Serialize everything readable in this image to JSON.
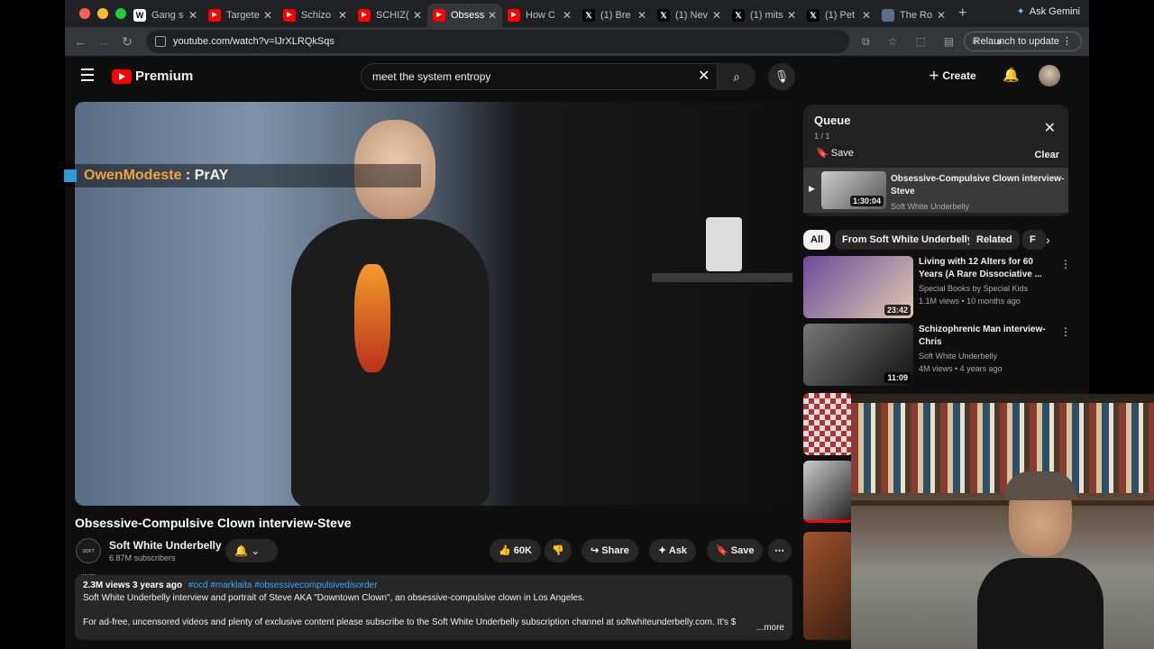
{
  "browser": {
    "tabs": [
      {
        "label": "Gang s",
        "fav": "W",
        "color": "#ffffff"
      },
      {
        "label": "Targete",
        "fav": "yt",
        "color": "#ff0000"
      },
      {
        "label": "Schizo",
        "fav": "yt",
        "color": "#ff0000"
      },
      {
        "label": "SCHIZ(",
        "fav": "yt",
        "color": "#ff0000"
      },
      {
        "label": "Obsess",
        "fav": "yt",
        "color": "#ff0000"
      },
      {
        "label": "How C",
        "fav": "yt",
        "color": "#ff0000"
      },
      {
        "label": "(1) Bre",
        "fav": "X",
        "color": "#000000"
      },
      {
        "label": "(1) Nev",
        "fav": "X",
        "color": "#000000"
      },
      {
        "label": "(1) mits",
        "fav": "X",
        "color": "#000000"
      },
      {
        "label": "(1) Pet",
        "fav": "X",
        "color": "#000000"
      },
      {
        "label": "The Ro",
        "fav": "doc",
        "color": "#5b6b8c"
      }
    ],
    "active_tab": 4,
    "gemini_label": "Ask Gemini",
    "url": "youtube.com/watch?v=lJrXLRQkSqs",
    "relaunch_label": "Relaunch to update"
  },
  "youtube": {
    "logo_text": "Premium",
    "search_value": "meet the system entropy",
    "create_label": "Create",
    "video_overlay": {
      "user": "OwenModeste",
      "message": " : PrAY"
    },
    "video_title": "Obsessive-Compulsive Clown interview-Steve",
    "channel": {
      "name": "Soft White Underbelly",
      "subscribers": "6.87M subscribers",
      "logo_text": "SOFT WHITE UNDERBELLY"
    },
    "actions": {
      "likes": "60K",
      "share": "Share",
      "ask": "Ask",
      "save": "Save"
    },
    "description": {
      "views": "2.3M views",
      "age": "3 years ago",
      "tags": "#ocd #marklaita #obsessivecompulsivedisorder",
      "line1": "Soft White Underbelly interview and portrait of Steve AKA \"Downtown Clown\", an obsessive-compulsive clown in Los Angeles.",
      "line2": "For ad-free, uncensored videos and plenty of exclusive content please subscribe to the Soft White Underbelly subscription channel at softwhiteunderbelly.com. It's $",
      "more": "...more"
    },
    "queue": {
      "title": "Queue",
      "count": "1 / 1",
      "save": "Save",
      "clear": "Clear",
      "item": {
        "title": "Obsessive-Compulsive Clown interview-Steve",
        "channel": "Soft White Underbelly",
        "duration": "1:30:04"
      }
    },
    "chips": [
      "All",
      "From Soft White Underbelly",
      "Related",
      "F"
    ],
    "recommendations": [
      {
        "title": "Living with 12 Alters for 60 Years (A Rare Dissociative ...",
        "channel": "Special Books by Special Kids",
        "meta": "1.1M views • 10 months ago",
        "duration": "23:42"
      },
      {
        "title": "Schizophrenic Man interview-Chris",
        "channel": "Soft White Underbelly",
        "meta": "4M views • 4 years ago",
        "duration": "11:09"
      }
    ]
  }
}
